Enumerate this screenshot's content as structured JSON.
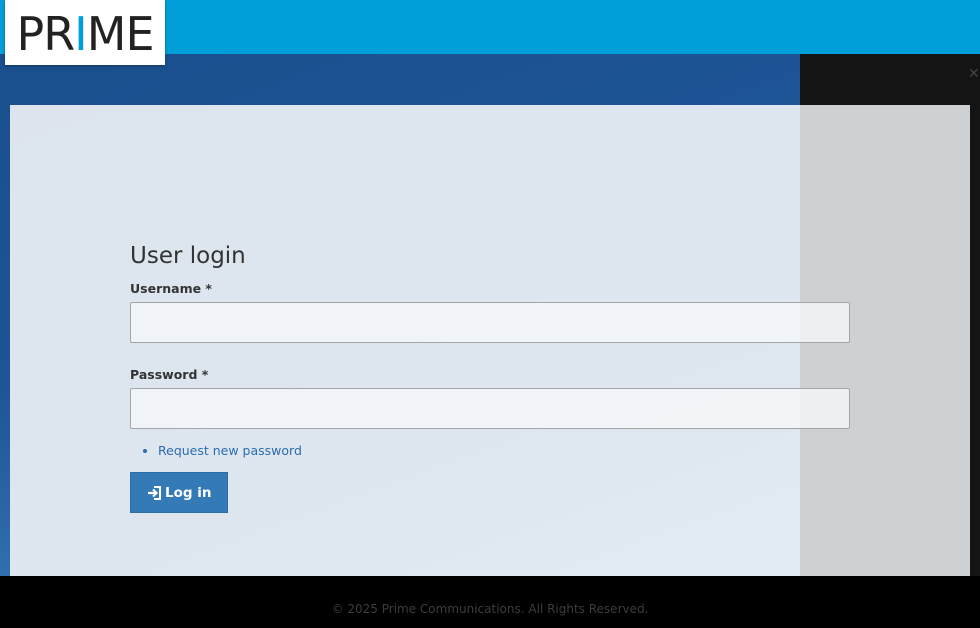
{
  "header": {
    "logo_prefix": "PR",
    "logo_i": "I",
    "logo_suffix": "ME",
    "brand_color": "#009fda"
  },
  "login": {
    "title": "User login",
    "username_label": "Username *",
    "username_value": "",
    "password_label": "Password *",
    "password_value": "",
    "links": [
      {
        "label": "Request new password"
      }
    ],
    "submit_label": "Log in",
    "submit_icon": "sign-in-icon",
    "button_color": "#337ab7"
  },
  "footer": {
    "copyright": "©  2025 Prime Communications. All Rights Reserved."
  }
}
